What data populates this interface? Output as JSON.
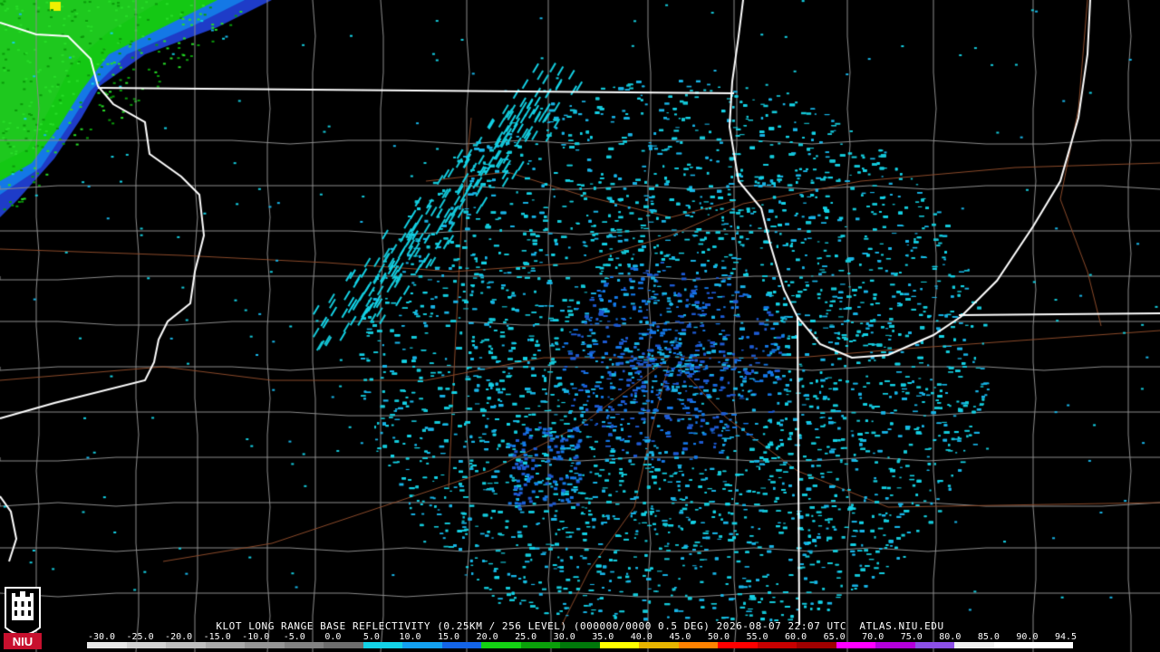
{
  "product": {
    "title": "KLOT LONG RANGE BASE REFLECTIVITY (0.25KM / 256 LEVEL) (000000/0000 0.5 DEG) 2026-08-07 22:07 UTC  ATLAS.NIU.EDU"
  },
  "logo": {
    "text": "NIU",
    "name": "niu-logo"
  },
  "colors": {
    "background": "#000000",
    "state_border": "#ffffff",
    "county_line": "#8c8c8c",
    "road": "#8b4a2a"
  },
  "color_scale": {
    "labels": [
      "-30.0",
      "-25.0",
      "-20.0",
      "-15.0",
      "-10.0",
      "-5.0",
      "0.0",
      "5.0",
      "10.0",
      "15.0",
      "20.0",
      "25.0",
      "30.0",
      "35.0",
      "40.0",
      "45.0",
      "50.0",
      "55.0",
      "60.0",
      "65.0",
      "70.0",
      "75.0",
      "80.0",
      "85.0",
      "90.0",
      "94.5"
    ],
    "colors": [
      "#e6e6e6",
      "#d2d2d2",
      "#bebebe",
      "#aaaaaa",
      "#969696",
      "#828282",
      "#6e6e6e",
      "#14d2e6",
      "#14a0f0",
      "#1464e6",
      "#14d214",
      "#0aa00a",
      "#00780a",
      "#ffff00",
      "#e6b400",
      "#ff8200",
      "#ff0000",
      "#c80000",
      "#a00000",
      "#ff00ff",
      "#b400dc",
      "#8c50e6",
      "#f0f0f0",
      "#ffffff",
      "#ffffff"
    ]
  }
}
